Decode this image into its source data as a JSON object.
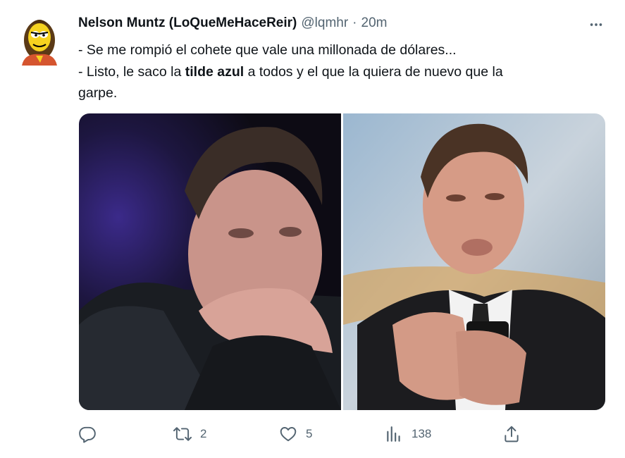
{
  "tweet": {
    "author_name": "Nelson Muntz (LoQueMeHaceReir)",
    "handle": "@lqmhr",
    "separator": "·",
    "time": "20m",
    "text_line1": "- Se me rompió el cohete que vale una millonada de dólares...",
    "text_line2_pre": "- Listo, le saco la ",
    "text_line2_bold": "tilde azul",
    "text_line2_post": " a todos y el que la quiera de nuevo que la",
    "text_line3": "garpe."
  },
  "actions": {
    "reply_count": "",
    "retweet_count": "2",
    "like_count": "5",
    "views_count": "138"
  },
  "icons": [
    "avatar-cartoon",
    "more-dots-icon",
    "reply-icon",
    "retweet-icon",
    "like-icon",
    "views-icon",
    "share-icon"
  ],
  "colors": {
    "text": "#0f1419",
    "secondary": "#536471"
  }
}
